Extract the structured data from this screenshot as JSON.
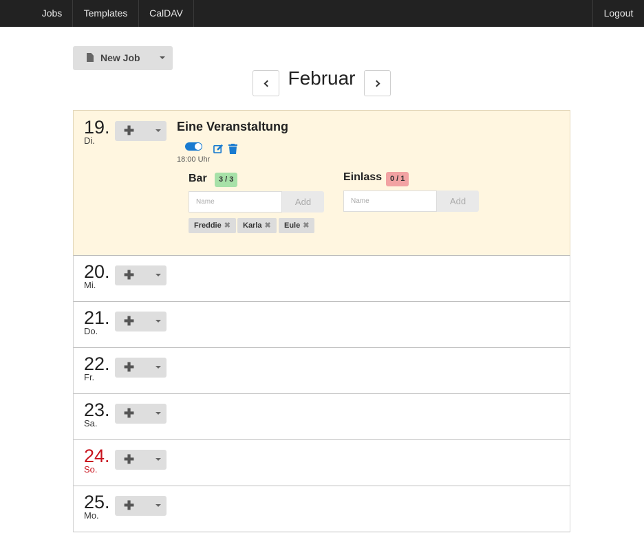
{
  "nav": {
    "jobs": "Jobs",
    "templates": "Templates",
    "caldav": "CalDAV",
    "logout": "Logout"
  },
  "toolbar": {
    "new_job_label": "New Job",
    "new_job_icon": "file-icon"
  },
  "calendar": {
    "month": "Februar",
    "days": [
      {
        "num": "19.",
        "name": "Di."
      },
      {
        "num": "20.",
        "name": "Mi."
      },
      {
        "num": "21.",
        "name": "Do."
      },
      {
        "num": "22.",
        "name": "Fr."
      },
      {
        "num": "23.",
        "name": "Sa."
      },
      {
        "num": "24.",
        "name": "So."
      },
      {
        "num": "25.",
        "name": "Mo."
      }
    ],
    "add_button_icon": "plus-icon"
  },
  "event": {
    "title": "Eine Veranstaltung",
    "time": "18:00 Uhr",
    "shifts": [
      {
        "title": "Bar",
        "count": "3 / 3",
        "name_placeholder": "Name",
        "add_label": "Add",
        "people": [
          "Freddie",
          "Karla",
          "Eule"
        ]
      },
      {
        "title": "Einlass",
        "count": "0 / 1",
        "name_placeholder": "Name",
        "add_label": "Add",
        "people": []
      }
    ]
  },
  "colors": {
    "nav_bg": "#222222",
    "highlight_bg": "#fff6e0",
    "sunday": "#c8141e",
    "badge_full": "#a7e1a8",
    "badge_open": "#f2a3a3",
    "accent": "#1a7bd0"
  }
}
